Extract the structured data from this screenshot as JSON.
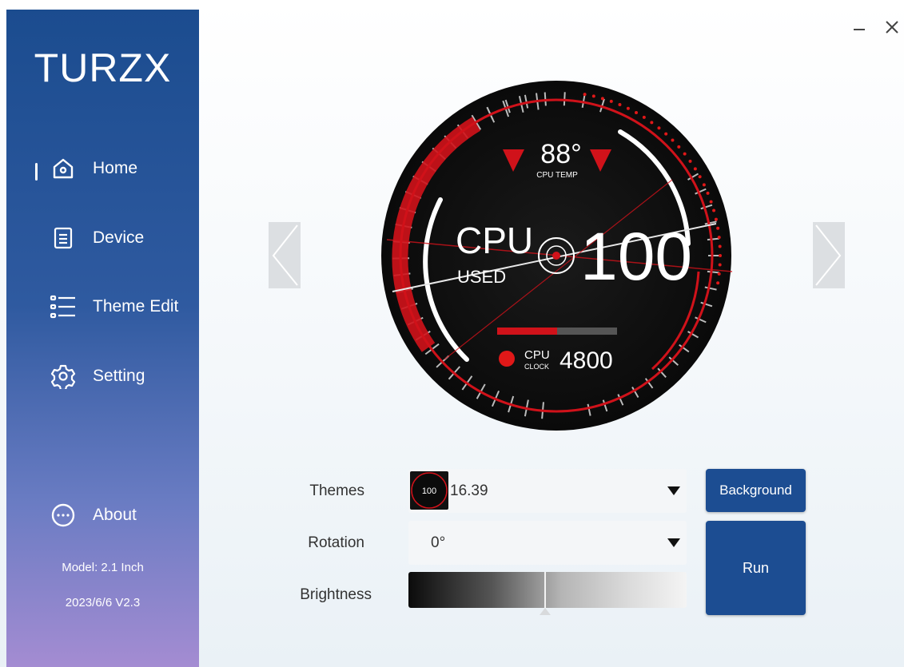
{
  "app": {
    "logo": "TURZX"
  },
  "sidebar": {
    "items": [
      {
        "label": "Home",
        "icon": "home-icon",
        "active": true
      },
      {
        "label": "Device",
        "icon": "document-icon"
      },
      {
        "label": "Theme Edit",
        "icon": "list-icon"
      },
      {
        "label": "Setting",
        "icon": "gear-icon"
      }
    ],
    "about": {
      "label": "About",
      "icon": "more-icon"
    },
    "model": "Model: 2.1 Inch",
    "version": "2023/6/6 V2.3"
  },
  "window": {
    "minimize_icon": "minimize-icon",
    "close_icon": "close-icon"
  },
  "preview": {
    "temp_value": "88°",
    "temp_label": "CPU TEMP",
    "cpu_word": "CPU",
    "used_word": "USED",
    "used_value": "100",
    "clock_word_top": "CPU",
    "clock_word_bottom": "CLOCK",
    "clock_value": "4800",
    "clock_bar_fraction": 0.5,
    "accent_color": "#e01818"
  },
  "controls": {
    "themes_label": "Themes",
    "themes_value": "16.39",
    "rotation_label": "Rotation",
    "rotation_value": "0°",
    "brightness_label": "Brightness",
    "brightness_fraction": 0.49,
    "background_button": "Background",
    "run_button": "Run",
    "thumbnail_text": "100"
  }
}
